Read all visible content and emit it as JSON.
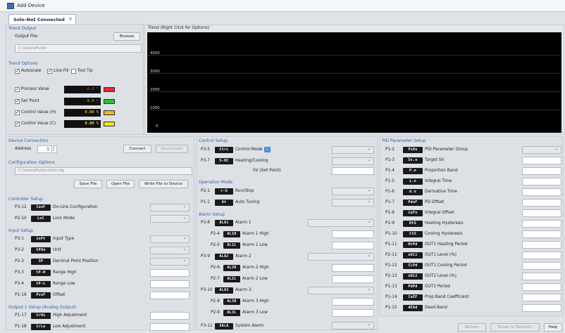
{
  "window": {
    "title": "Add Device"
  },
  "tab": {
    "label": "Solo-Not Connected",
    "close": "×"
  },
  "trend_output": {
    "section": "Trend Output",
    "file_label": "Output File:",
    "browse": "Browse",
    "path": "C:\\Users\\Public"
  },
  "trend_options": {
    "section": "Trend Options",
    "autoscale": "Autoscale",
    "line_fill": "Line Fill",
    "tool_tip": "Tool Tip",
    "process_value": "Process Value",
    "pv_display": "0.0 °",
    "set_point": "Set Point",
    "sp_display": "0.0 °",
    "cv_h": "Control Value (H)",
    "cvh_display": "0.00 %",
    "cv_c": "Control Value (C)",
    "cvc_display": "0.00 %",
    "colors": {
      "pv": "#e3262e",
      "sp": "#22c42f",
      "cvh": "#f0b32a",
      "cvc": "#f2e41c"
    }
  },
  "trend": {
    "title": "Trend  (Right Click for Options)",
    "yticks": [
      "4000",
      "3000",
      "2000",
      "1000",
      "0"
    ]
  },
  "device_connection": {
    "section": "Device Connection",
    "address_label": "Address",
    "address_value": "1",
    "connect": "Connect",
    "disconnect": "Disconnect"
  },
  "config_options": {
    "section": "Configuration Options",
    "path": "C:\\Users\\Public\\Solo.cfg",
    "save": "Save File",
    "open": "Open File",
    "write": "Write File to Device"
  },
  "controller_setup": {
    "section": "Controller Setup",
    "rows": [
      {
        "code": "P3-12",
        "lcd": "ConF",
        "label": "On-Line Configuration"
      },
      {
        "code": "P2-10",
        "lcd": "LoC",
        "label": "Lock Mode"
      }
    ]
  },
  "input_setup": {
    "section": "Input Setup",
    "rows": [
      {
        "code": "P3-1",
        "lcd": "inPt",
        "label": "Input Type"
      },
      {
        "code": "P3-2",
        "lcd": "tPUn",
        "label": "Unit"
      },
      {
        "code": "P2-3",
        "lcd": "SP",
        "label": "Decimal Point Position"
      },
      {
        "code": "P3-3",
        "lcd": "tP-H",
        "label": "Range High"
      },
      {
        "code": "P3-4",
        "lcd": "tP-L",
        "label": "Range Low"
      },
      {
        "code": "P1-16",
        "lcd": "PvoF",
        "label": "Offset"
      }
    ]
  },
  "output_setup": {
    "section": "Output 1 Setup (Analog Output)",
    "rows": [
      {
        "code": "P1-17",
        "lcd": "CrHi",
        "label": "High Adjustment"
      },
      {
        "code": "P1-18",
        "lcd": "CrLo",
        "label": "Low Adjustment"
      }
    ]
  },
  "control_setup": {
    "section": "Control Setup",
    "rows": [
      {
        "code": "P3-5",
        "lcd": "CtrL",
        "label": "Control Mode"
      },
      {
        "code": "P3-7",
        "lcd": "S-HC",
        "label": "Heating/Cooling"
      }
    ],
    "sv_label": "SV (Set Point)"
  },
  "operation_mode": {
    "section": "Operation Mode",
    "rows": [
      {
        "code": "P2-1",
        "lcd": "r-S",
        "label": "Run/Stop"
      },
      {
        "code": "P1-1",
        "lcd": "At",
        "label": "Auto Tuning"
      }
    ]
  },
  "alarm_setup": {
    "section": "Alarm Setup",
    "alarms": [
      {
        "code": "P3-8",
        "lcd": "ALA1",
        "label": "Alarm 1",
        "high_code": "P2-4",
        "high_lcd": "AL1H",
        "high": "Alarm 1 High",
        "low_code": "P2-5",
        "low_lcd": "AL1L",
        "low": "Alarm 1 Low"
      },
      {
        "code": "P3-9",
        "lcd": "ALA2",
        "label": "Alarm 2",
        "high_code": "P2-6",
        "high_lcd": "AL2H",
        "high": "Alarm 2 High",
        "low_code": "P2-7",
        "low_lcd": "AL2L",
        "low": "Alarm 2 Low"
      },
      {
        "code": "P3-10",
        "lcd": "ALA3",
        "label": "Alarm 3",
        "high_code": "P2-8",
        "high_lcd": "AL3H",
        "high": "Alarm 3 High",
        "low_code": "P2-9",
        "low_lcd": "AL3L",
        "low": "Alarm 3 Low"
      }
    ],
    "sys": {
      "code": "P3-11",
      "lcd": "SALA",
      "label": "System Alarm"
    }
  },
  "pid_setup": {
    "section": "PID Parameter Setup",
    "rows": [
      {
        "code": "P1-2",
        "lcd": "PiDn",
        "label": "PID Parameter Group"
      },
      {
        "code": "P1-3",
        "lcd": "Sv.n",
        "label": "Target SV"
      },
      {
        "code": "P1-4",
        "lcd": "P.n",
        "label": "Proportion Band"
      },
      {
        "code": "P1-5",
        "lcd": "i.n",
        "label": "Integral Time"
      },
      {
        "code": "P1-6",
        "lcd": "d.n",
        "label": "Derivative Time"
      },
      {
        "code": "P1-7",
        "lcd": "PdoF",
        "label": "PD Offset"
      },
      {
        "code": "P1-8",
        "lcd": "ioFn",
        "label": "Integral Offset"
      },
      {
        "code": "P1-9",
        "lcd": "HtS",
        "label": "Heating Hysteresis"
      },
      {
        "code": "P1-10",
        "lcd": "CtS",
        "label": "Cooling Hysteresis"
      },
      {
        "code": "P1-11",
        "lcd": "HtPd",
        "label": "OUT1 Heating Period"
      },
      {
        "code": "P2-11",
        "lcd": "oUL1",
        "label": "OUT1 Level (%)"
      },
      {
        "code": "P1-12",
        "lcd": "CLPd",
        "label": "OUT1 Cooling Period"
      },
      {
        "code": "P2-12",
        "lcd": "oUL2",
        "label": "OUT2 Level (%)"
      },
      {
        "code": "P1-13",
        "lcd": "PdPd",
        "label": "OUT2 Period"
      },
      {
        "code": "P1-14",
        "lcd": "CoEF",
        "label": "Prop Band Coefficient"
      },
      {
        "code": "P1-15",
        "lcd": "dEAd",
        "label": "Dead Band"
      }
    ]
  },
  "footer": {
    "refresh": "Refresh",
    "reset": "Reset to Defaults",
    "help": "Help"
  }
}
